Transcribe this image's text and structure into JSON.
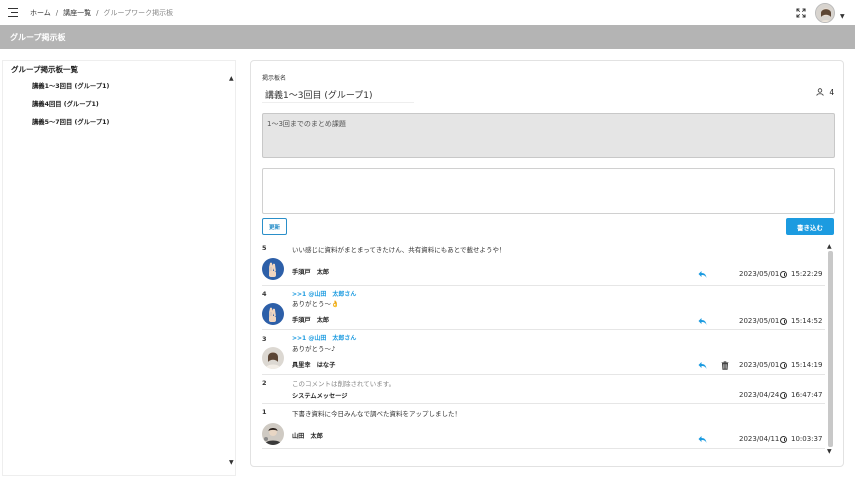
{
  "breadcrumb": {
    "home": "ホーム",
    "sep1": "/",
    "course_list": "講座一覧",
    "sep2": "/",
    "current": "グループワーク掲示板"
  },
  "page_title": "グループ掲示板",
  "sidebar": {
    "heading": "グループ掲示板一覧",
    "items": [
      {
        "label": "講義1〜3回目 (グループ1)"
      },
      {
        "label": "講義4回目 (グループ1)"
      },
      {
        "label": "講義5〜7回目 (グループ1)"
      }
    ]
  },
  "board": {
    "name_label": "掲示板名",
    "name": "講義1〜3回目 (グループ1)",
    "member_count": "4",
    "description": "1〜3回までのまとめ課題",
    "input_value": "",
    "refresh_label": "更新",
    "post_label": "書き込む"
  },
  "posts": [
    {
      "number": "5",
      "reply_to": "",
      "body": "いい感じに資料がまとまってきたけん、共有資料にもあとで載せようや！",
      "author": "手須戸　太郎",
      "date": "2023/05/01",
      "time": "15:22:29",
      "avatar": "peace-sign",
      "deleted": false,
      "can_delete": false
    },
    {
      "number": "4",
      "reply_to": ">>1 @山田　太郎さん",
      "body": "ありがとう〜👌",
      "author": "手須戸　太郎",
      "date": "2023/05/01",
      "time": "15:14:52",
      "avatar": "peace-sign",
      "deleted": false,
      "can_delete": false
    },
    {
      "number": "3",
      "reply_to": ">>1 @山田　太郎さん",
      "body": "ありがとう〜♪",
      "author": "具里幸　はな子",
      "date": "2023/05/01",
      "time": "15:14:19",
      "avatar": "woman",
      "deleted": false,
      "can_delete": true
    },
    {
      "number": "2",
      "reply_to": "",
      "body": "このコメントは削除されています。",
      "author": "システムメッセージ",
      "date": "2023/04/24",
      "time": "16:47:47",
      "avatar": "",
      "deleted": true,
      "can_delete": false
    },
    {
      "number": "1",
      "reply_to": "",
      "body": "下書き資料に今日みんなで調べた資料をアップしました！",
      "author": "山田　太郎",
      "date": "2023/04/11",
      "time": "10:03:37",
      "avatar": "man",
      "deleted": false,
      "can_delete": false
    }
  ],
  "colors": {
    "accent": "#1c9be0",
    "header_bar": "#b4b4b4",
    "description_bg": "#e5e5e5"
  }
}
